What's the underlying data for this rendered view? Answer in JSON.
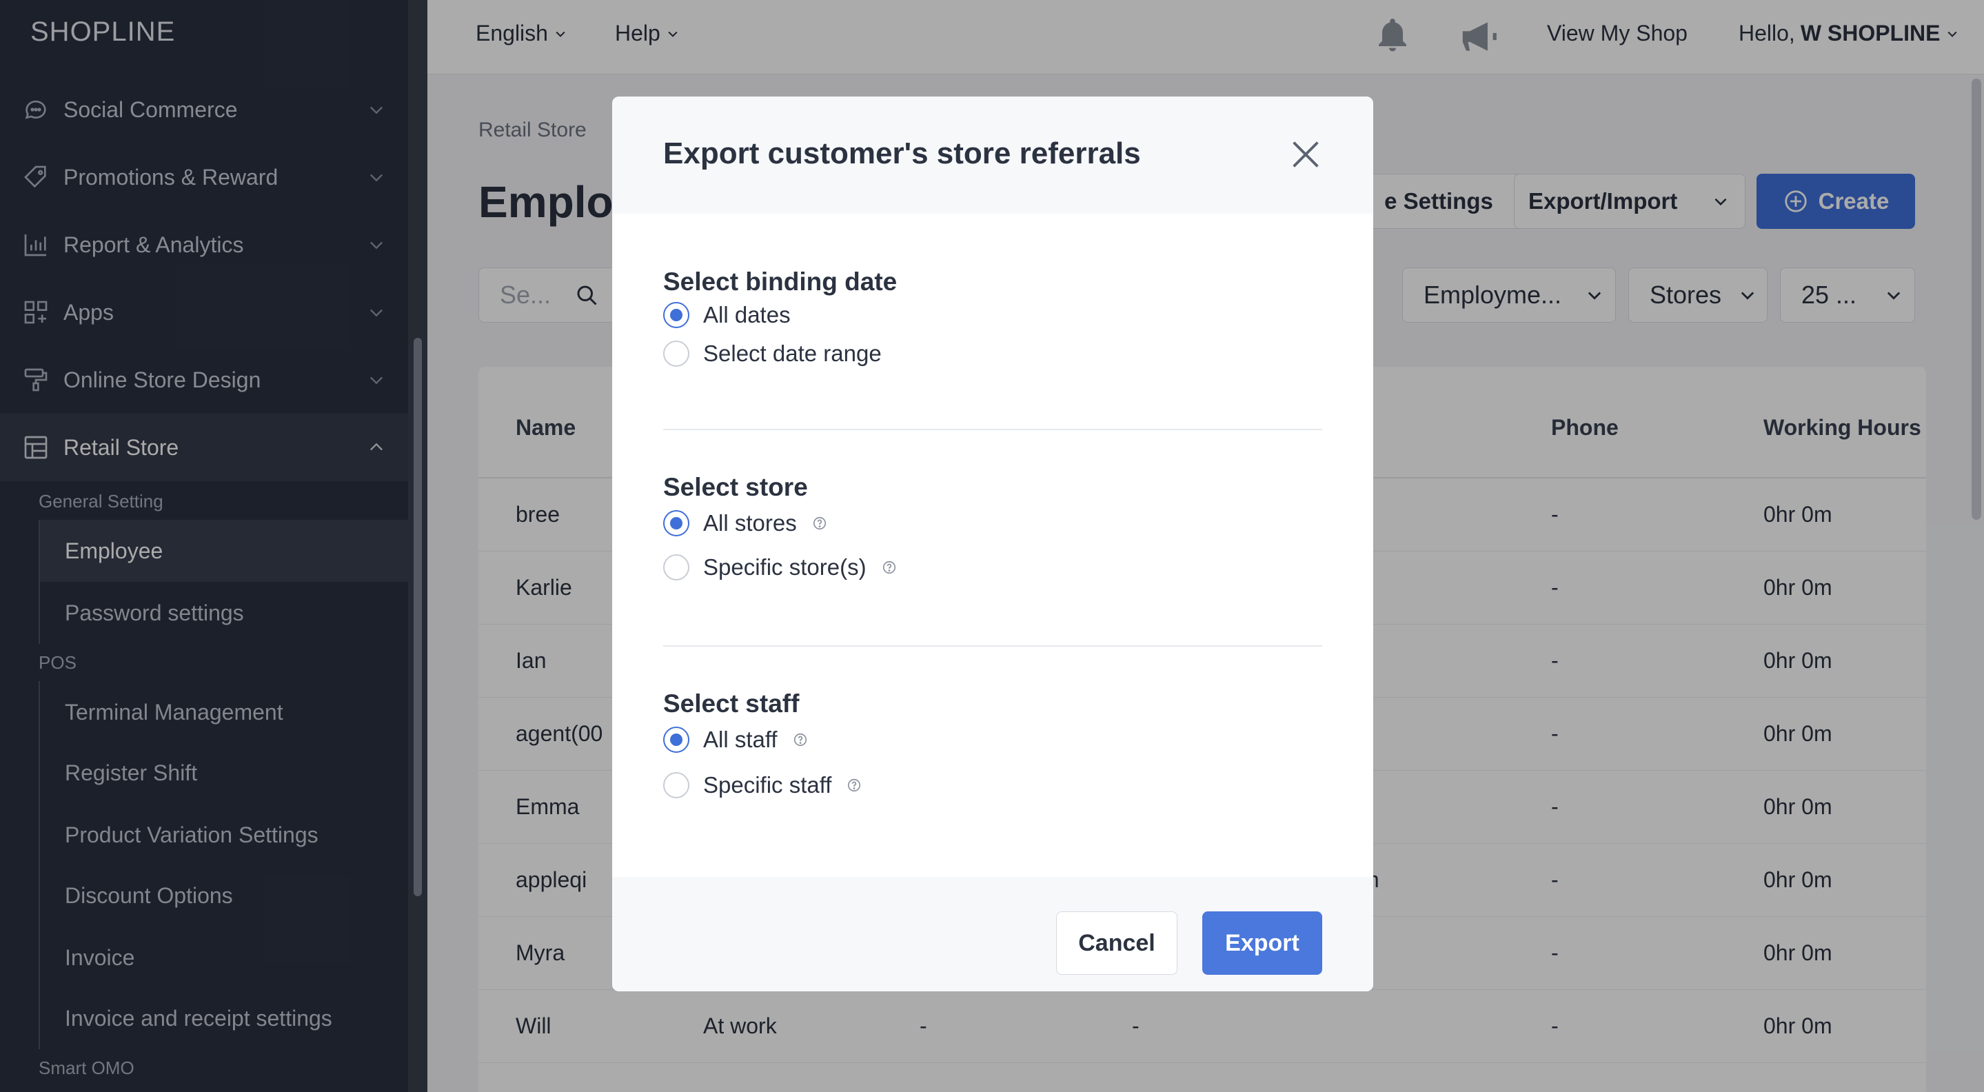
{
  "app": {
    "logo": "SHOPLINE"
  },
  "sidebar": {
    "menu": [
      {
        "label": "Social Commerce",
        "icon": "chat-icon"
      },
      {
        "label": "Promotions & Reward",
        "icon": "tag-icon"
      },
      {
        "label": "Report & Analytics",
        "icon": "bar-chart-icon"
      },
      {
        "label": "Apps",
        "icon": "apps-grid-icon"
      },
      {
        "label": "Online Store Design",
        "icon": "paint-roller-icon"
      },
      {
        "label": "Retail Store",
        "icon": "store-icon"
      }
    ],
    "groups": {
      "general": "General Setting",
      "pos": "POS",
      "smart": "Smart OMO"
    },
    "general_items": [
      "Employee",
      "Password settings"
    ],
    "pos_items": [
      "Terminal Management",
      "Register Shift",
      "Product Variation Settings",
      "Discount Options",
      "Invoice",
      "Invoice and receipt settings"
    ]
  },
  "topbar": {
    "language": "English",
    "help": "Help",
    "view_shop": "View My Shop",
    "greeting": "Hello,",
    "user": "W SHOPLINE"
  },
  "page": {
    "breadcrumb": "Retail Store",
    "title": "Employ",
    "settings_btn": "e Settings",
    "export_import_btn": "Export/Import",
    "create_btn": "Create",
    "search_placeholder": "Se...",
    "filter_employee": "Employme...",
    "filter_stores": "Stores",
    "filter_per_page": "25 ..."
  },
  "table": {
    "headers": {
      "name": "Name",
      "phone": "Phone",
      "hours": "Working Hours"
    },
    "rows": [
      {
        "name": "bree",
        "status": "",
        "c3": "",
        "c4": "",
        "phone": "-",
        "hours": "0hr 0m"
      },
      {
        "name": "Karlie",
        "status": "",
        "c3": "",
        "c4": "",
        "phone": "-",
        "hours": "0hr 0m"
      },
      {
        "name": "Ian",
        "status": "",
        "c3": "",
        "c4": "",
        "phone": "-",
        "hours": "0hr 0m"
      },
      {
        "name": "agent(00",
        "status": "",
        "c3": "",
        "c4": "",
        "phone": "-",
        "hours": "0hr 0m"
      },
      {
        "name": "Emma",
        "status": "",
        "c3": "",
        "c4": "",
        "phone": "-",
        "hours": "0hr 0m"
      },
      {
        "name": "appleqi",
        "status": "",
        "c3": "",
        "c4": "m",
        "phone": "-",
        "hours": "0hr 0m"
      },
      {
        "name": "Myra",
        "status": "",
        "c3": "",
        "c4": "",
        "phone": "-",
        "hours": "0hr 0m"
      },
      {
        "name": "Will",
        "status": "At work",
        "c3": "-",
        "c4": "-",
        "phone": "-",
        "hours": "0hr 0m"
      }
    ]
  },
  "modal": {
    "title": "Export customer's store referrals",
    "binding_date": {
      "title": "Select binding date",
      "options": [
        "All dates",
        "Select date range"
      ],
      "selected": 0
    },
    "store": {
      "title": "Select store",
      "options": [
        "All stores",
        "Specific store(s)"
      ],
      "selected": 0
    },
    "staff": {
      "title": "Select staff",
      "options": [
        "All staff",
        "Specific staff"
      ],
      "selected": 0
    },
    "cancel": "Cancel",
    "export": "Export"
  },
  "colors": {
    "primary": "#3f6fd8",
    "sidebar": "#2b3140"
  }
}
